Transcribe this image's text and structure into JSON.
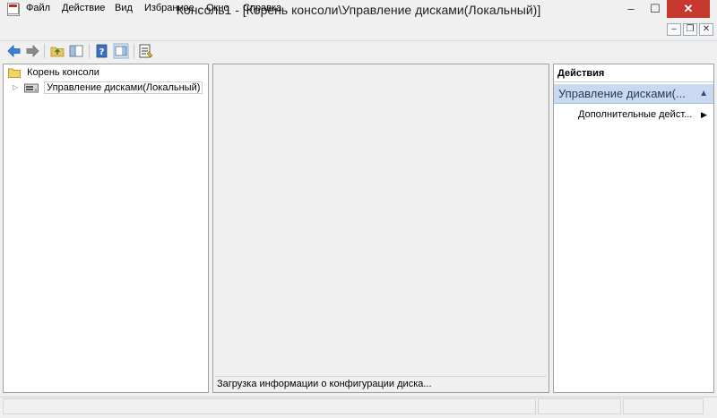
{
  "window": {
    "title": "Консоль1 - [Корень консоли\\Управление дисками(Локальный)]",
    "controls": {
      "minimize": "–",
      "maximize": "☐",
      "close": "✕"
    }
  },
  "menu": {
    "items": [
      "Файл",
      "Действие",
      "Вид",
      "Избранное",
      "Окно",
      "Справка"
    ],
    "mdi": {
      "minimize": "–",
      "restore": "❐",
      "close": "✕"
    }
  },
  "toolbar": {
    "icons": [
      "back-arrow-icon",
      "forward-arrow-icon",
      "up-folder-icon",
      "show-hide-tree-icon",
      "help-icon",
      "show-hide-action-pane-icon",
      "properties-icon"
    ]
  },
  "tree": {
    "root_label": "Корень консоли",
    "child_label": "Управление дисками(Локальный)"
  },
  "center": {
    "status_text": "Загрузка информации о конфигурации диска..."
  },
  "actions": {
    "header": "Действия",
    "section_label": "Управление дисками(...",
    "more_actions": "Дополнительные дейст..."
  },
  "colors": {
    "close_red": "#c7392f",
    "section_blue": "#c9daf0",
    "arrow_blue": "#3b82d6"
  }
}
